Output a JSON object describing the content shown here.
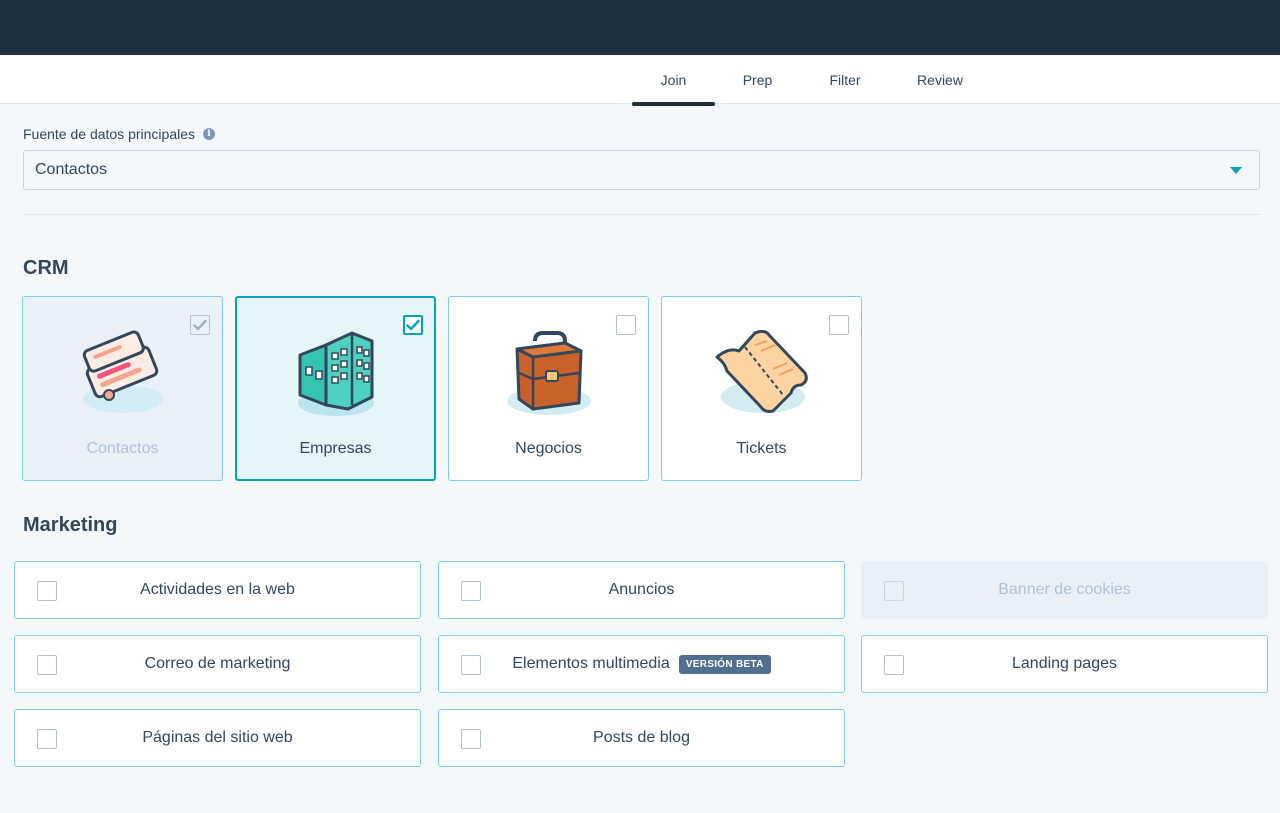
{
  "tabs": [
    {
      "label": "Join"
    },
    {
      "label": "Prep"
    },
    {
      "label": "Filter"
    },
    {
      "label": "Review"
    }
  ],
  "primary_source": {
    "label": "Fuente de datos principales",
    "value": "Contactos"
  },
  "crm": {
    "title": "CRM",
    "cards": [
      {
        "label": "Contactos",
        "state": "disabled"
      },
      {
        "label": "Empresas",
        "state": "selected"
      },
      {
        "label": "Negocios",
        "state": "unchecked"
      },
      {
        "label": "Tickets",
        "state": "unchecked"
      }
    ]
  },
  "marketing": {
    "title": "Marketing",
    "items": [
      {
        "label": "Actividades en la web"
      },
      {
        "label": "Anuncios"
      },
      {
        "label": "Banner de cookies"
      },
      {
        "label": "Correo de marketing"
      },
      {
        "label": "Elementos multimedia",
        "badge": "VERSIÓN BETA"
      },
      {
        "label": "Landing pages"
      },
      {
        "label": "Páginas del sitio web"
      },
      {
        "label": "Posts de blog"
      }
    ]
  },
  "colors": {
    "topbar": "#1f2e3d",
    "accent": "#00a4bd",
    "card_border": "#7fd1de",
    "text": "#33475b"
  }
}
